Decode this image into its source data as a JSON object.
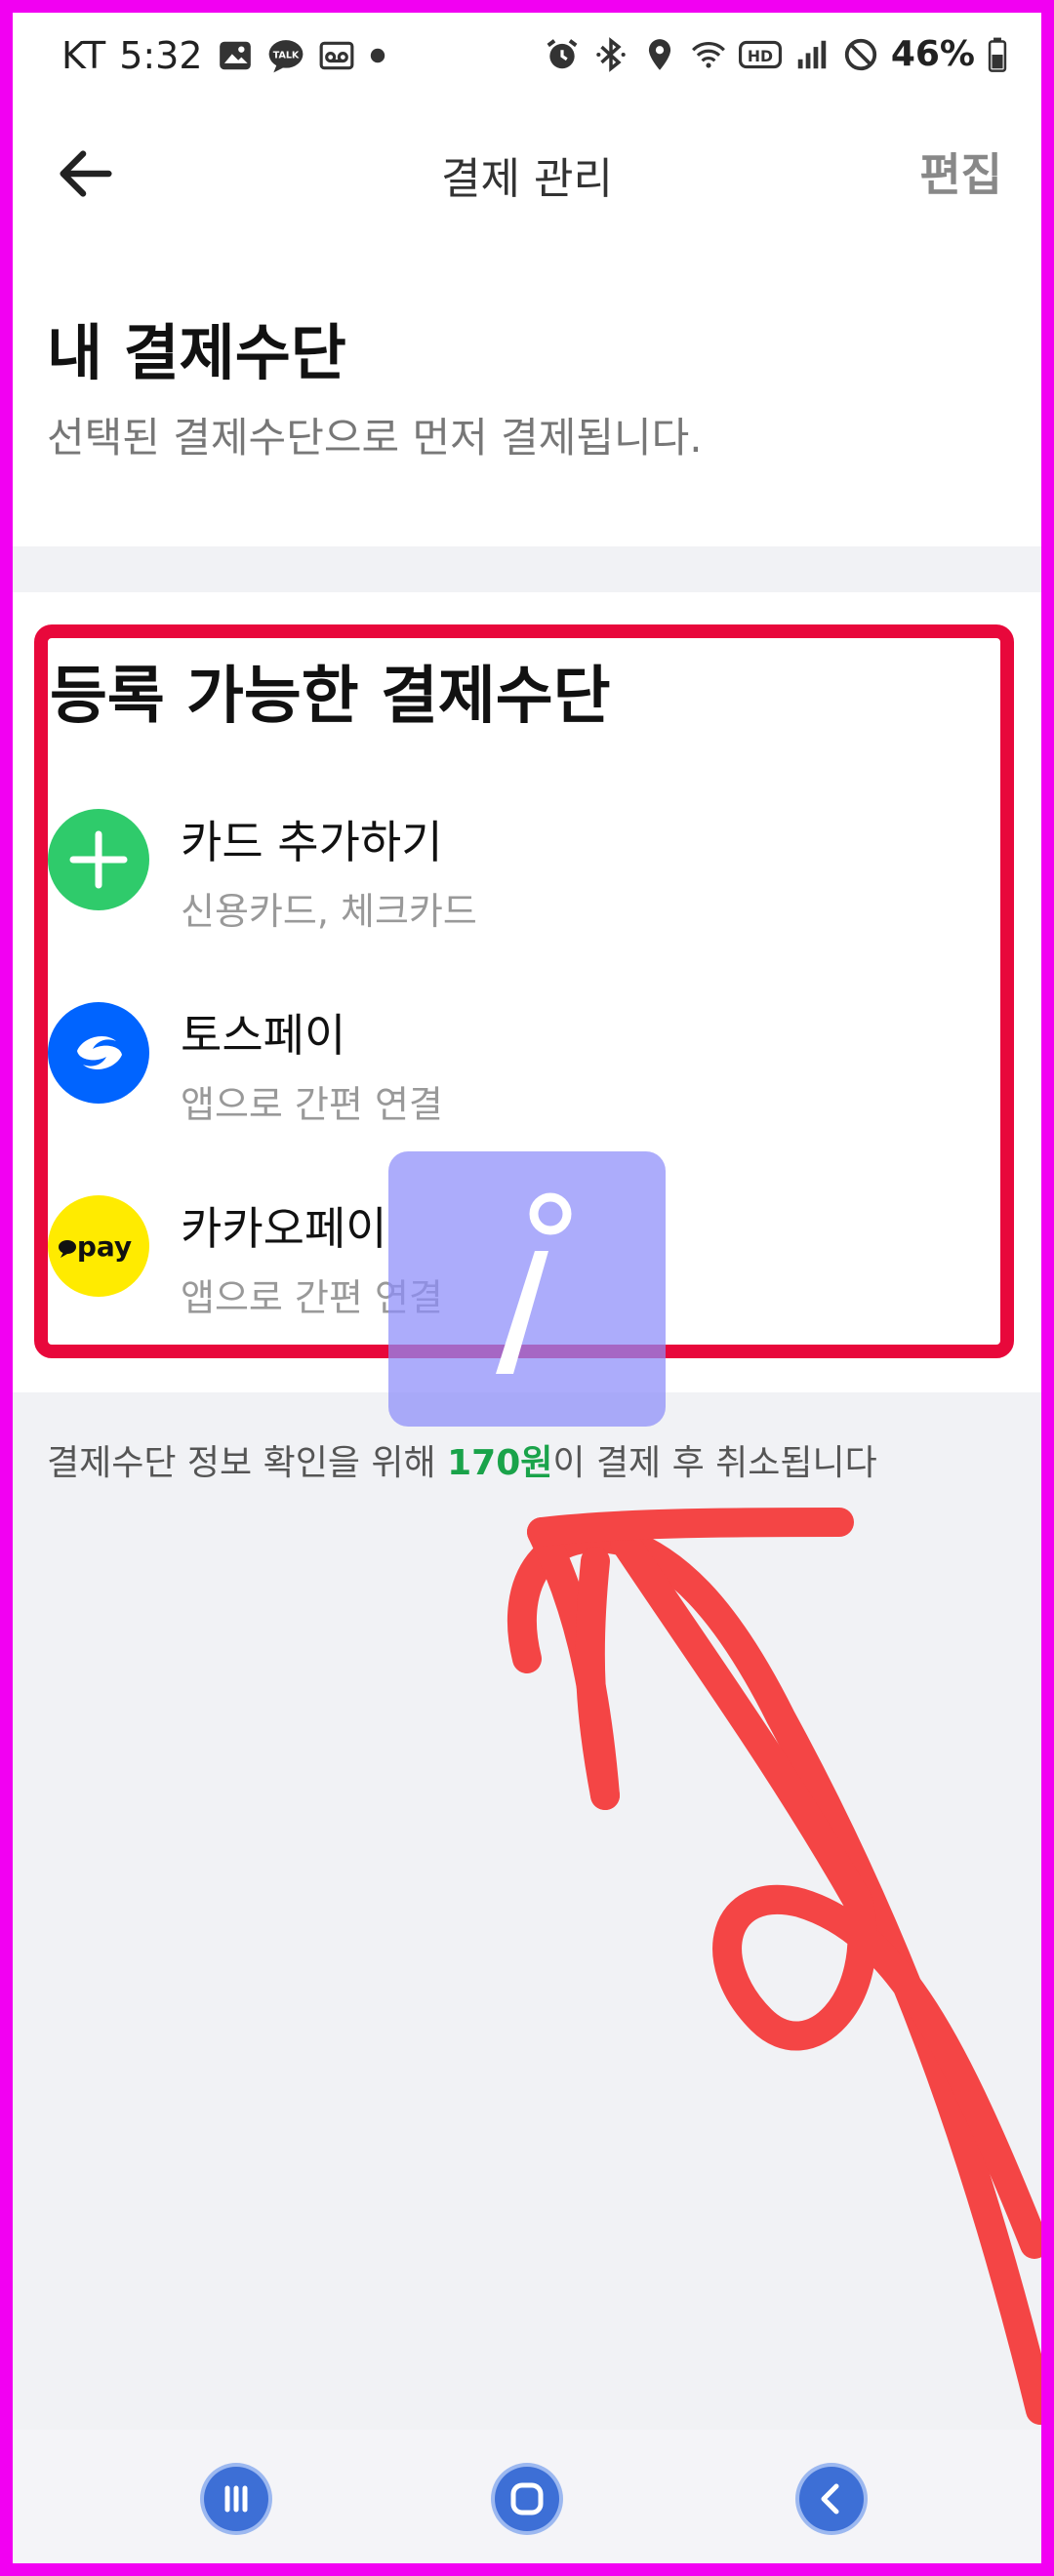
{
  "status_bar": {
    "carrier": "KT",
    "time": "5:32",
    "battery": "46%",
    "icons": [
      "gallery-icon",
      "talk-icon",
      "voicemail-icon",
      "dot-icon",
      "alarm-icon",
      "bluetooth-icon",
      "location-icon",
      "wifi-icon",
      "hd-icon",
      "signal-icon",
      "dnd-icon",
      "battery-icon"
    ],
    "talk_label": "TALK",
    "hd_label": "HD"
  },
  "header": {
    "title": "결제 관리",
    "edit_label": "편집",
    "back_icon": "arrow-left-icon"
  },
  "my_payment": {
    "title": "내 결제수단",
    "subtitle": "선택된 결제수단으로 먼저 결제됩니다."
  },
  "available": {
    "title": "등록 가능한 결제수단",
    "items": [
      {
        "name": "카드 추가하기",
        "desc": "신용카드, 체크카드",
        "icon": "plus-icon",
        "color": "#2fcb6b"
      },
      {
        "name": "토스페이",
        "desc": "앱으로 간편 연결",
        "icon": "toss-icon",
        "color": "#0064ff"
      },
      {
        "name": "카카오페이",
        "desc": "앱으로 간편 연결",
        "icon": "kakaopay-icon",
        "color": "#ffeb00",
        "logo_text": "pay"
      }
    ]
  },
  "notice": {
    "before": "결제수단 정보 확인을 위해 ",
    "amount": "170원",
    "after": "이 결제 후 취소됩니다"
  },
  "overlay": {
    "icon": "info-icon"
  },
  "colors": {
    "frame": "#f200f2",
    "highlight": "#e8083b",
    "annotation_arrow": "#f44545",
    "amount": "#1aa34a"
  },
  "nav_bar": {
    "icons": [
      "recent-apps-icon",
      "home-icon",
      "back-icon"
    ]
  }
}
